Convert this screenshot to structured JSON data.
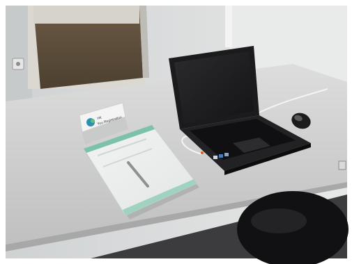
{
  "photo": {
    "name_card": {
      "line1": "Hit",
      "line2": "You Registration"
    }
  }
}
